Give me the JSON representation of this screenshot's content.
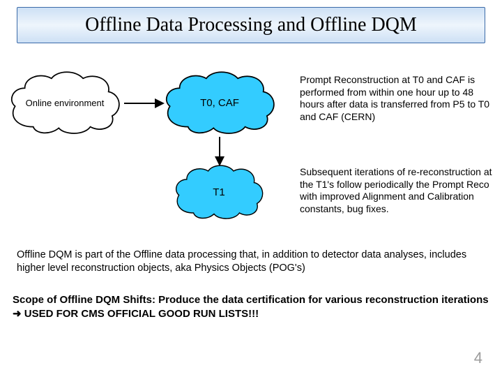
{
  "title": "Offline Data Processing and Offline DQM",
  "clouds": {
    "online": {
      "label": "Online environment"
    },
    "t0caf": {
      "label": "T0, CAF"
    },
    "t1": {
      "label": "T1"
    }
  },
  "descriptions": {
    "d1": "Prompt Reconstruction at T0 and CAF is performed from within one hour up to 48 hours after data is transferred from P5 to T0 and CAF (CERN)",
    "d2": "Subsequent iterations of re-reconstruction at the T1's follow periodically the Prompt Reco with improved Alignment and Calibration constants, bug fixes."
  },
  "para_offline": "Offline DQM is part of the Offline data processing that, in addition to detector data analyses, includes higher level reconstruction objects, aka Physics Objects (POG's)",
  "scope": {
    "part1": "Scope of Offline DQM Shifts: Produce the  data certification for various reconstruction iterations ",
    "arrow": "➜",
    "part2": " USED FOR CMS OFFICIAL GOOD RUN LISTS!!!"
  },
  "slide_number": "4",
  "colors": {
    "cloud_outline": "#000000",
    "cloud_blue": "#33ccff",
    "cloud_white": "#ffffff"
  }
}
